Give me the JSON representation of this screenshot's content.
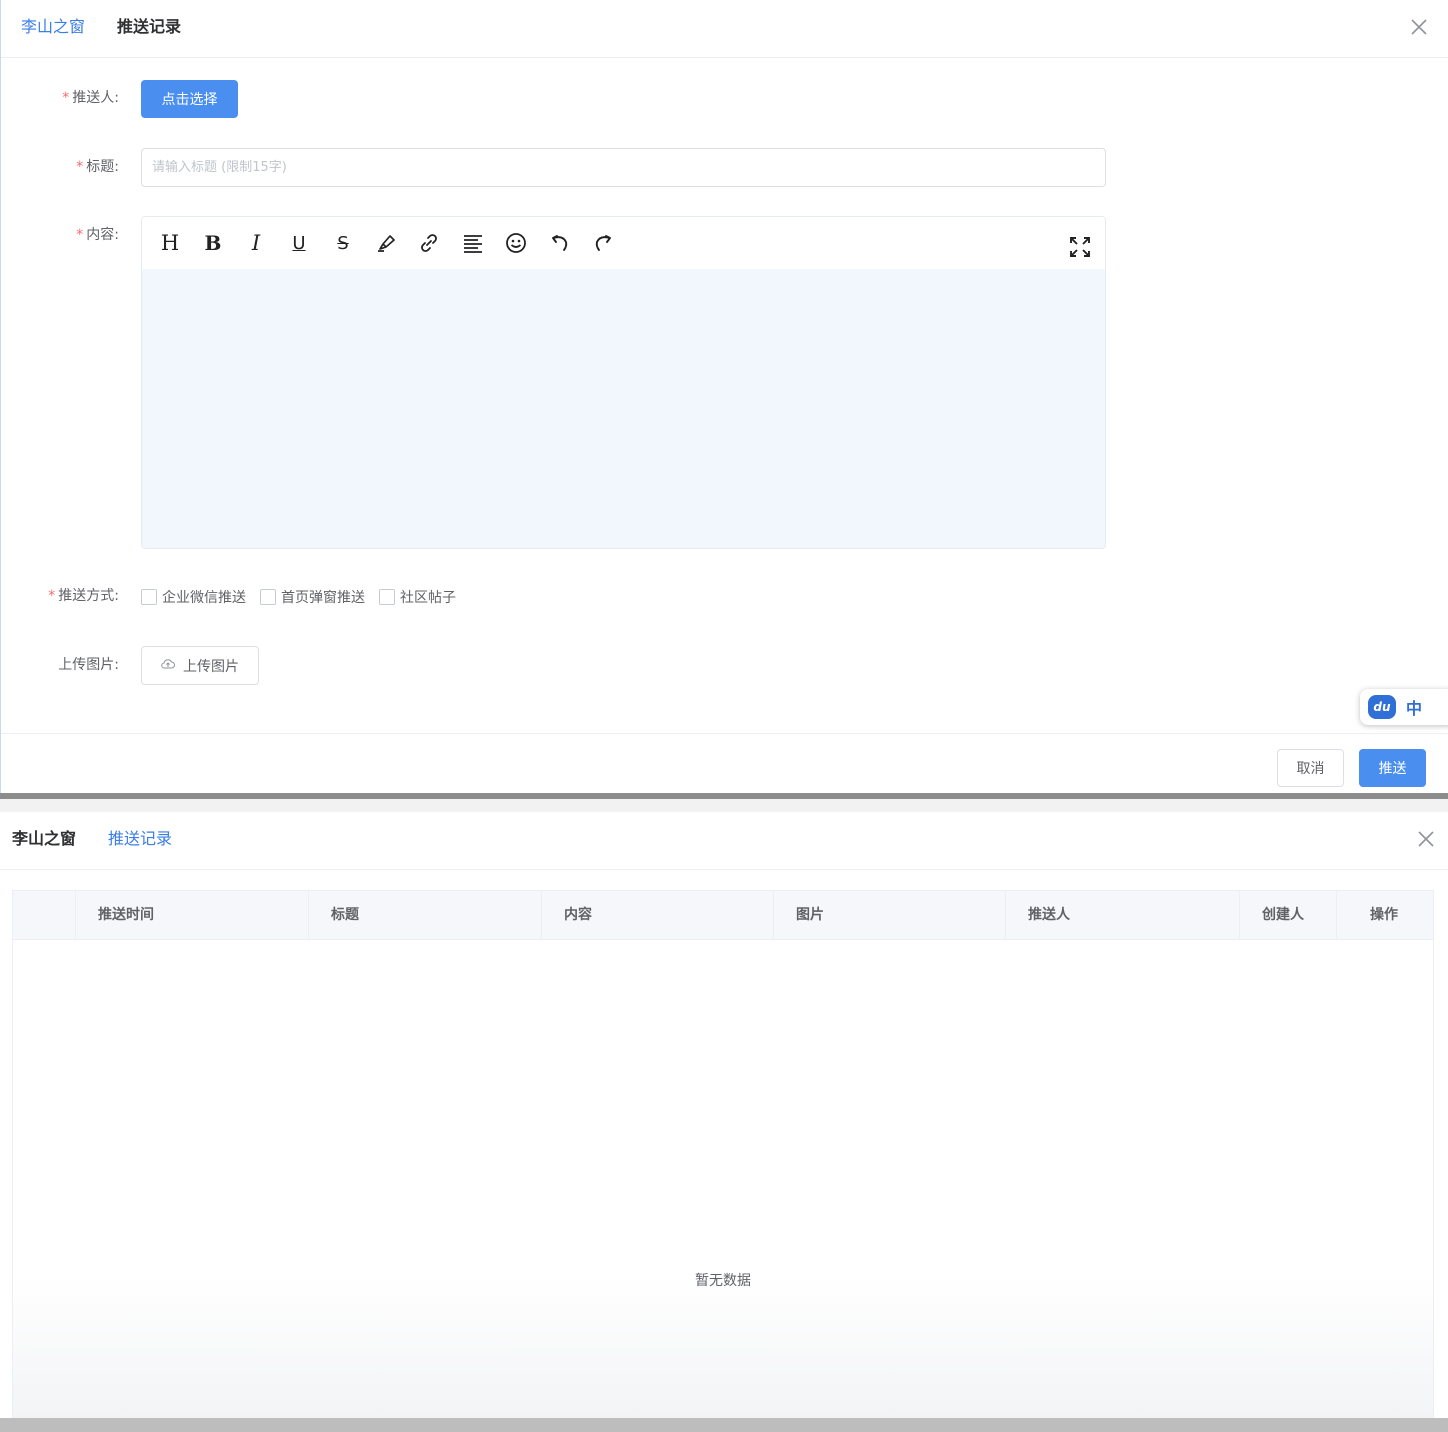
{
  "form_dialog": {
    "tabs": [
      {
        "label": "李山之窗",
        "active": true
      },
      {
        "label": "推送记录",
        "active": false
      }
    ],
    "close_icon": "close-icon",
    "fields": {
      "pusher": {
        "label": "推送人:",
        "required": true,
        "button_label": "点击选择"
      },
      "title": {
        "label": "标题:",
        "required": true,
        "value": "",
        "placeholder": "请输入标题 (限制15字)"
      },
      "content": {
        "label": "内容:",
        "required": true,
        "toolbar_icons": [
          "heading-icon",
          "bold-icon",
          "italic-icon",
          "underline-icon",
          "strikethrough-icon",
          "highlight-pen-icon",
          "link-icon",
          "align-icon",
          "emoji-icon",
          "undo-icon",
          "redo-icon",
          "fullscreen-icon"
        ],
        "toolbar_glyphs": {
          "heading": "H",
          "bold": "B",
          "italic": "I",
          "underline": "U",
          "strikethrough": "S"
        }
      },
      "push_method": {
        "label": "推送方式:",
        "required": true,
        "options": [
          {
            "label": "企业微信推送",
            "checked": false
          },
          {
            "label": "首页弹窗推送",
            "checked": false
          },
          {
            "label": "社区帖子",
            "checked": false
          }
        ]
      },
      "upload": {
        "label": "上传图片:",
        "required": false,
        "button_label": "上传图片",
        "icon": "cloud-upload-icon"
      }
    },
    "footer": {
      "cancel_label": "取消",
      "submit_label": "推送"
    },
    "accent_color": "#4a8ff0"
  },
  "ime_widget": {
    "logo_text": "du",
    "lang": "中"
  },
  "records_dialog": {
    "tabs": [
      {
        "label": "李山之窗",
        "active": false
      },
      {
        "label": "推送记录",
        "active": true
      }
    ],
    "close_icon": "close-icon",
    "table": {
      "columns": [
        "",
        "推送时间",
        "标题",
        "内容",
        "图片",
        "推送人",
        "创建人",
        "操作"
      ],
      "rows": [],
      "empty_text": "暂无数据"
    }
  }
}
